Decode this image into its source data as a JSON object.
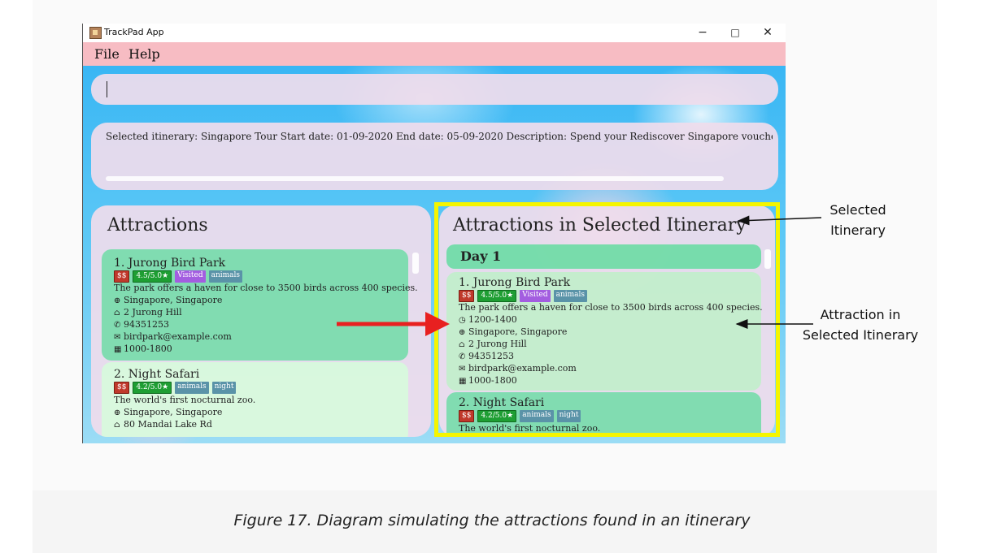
{
  "window": {
    "title": "TrackPad App",
    "controls": {
      "minimize": "−",
      "maximize": "□",
      "close": "✕"
    }
  },
  "menu": {
    "items": [
      "File",
      "Help"
    ]
  },
  "command_box": {
    "value": ""
  },
  "result_display": {
    "text": "Selected itinerary: Singapore Tour Start date: 01-09-2020 End date: 05-09-2020 Description: Spend your Rediscover Singapore vouchers here! Budg"
  },
  "attractions_panel": {
    "title": "Attractions",
    "items": [
      {
        "name": "1.  Jurong Bird Park",
        "price": "$$",
        "rating": "4.5/5.0★",
        "tags": [
          "Visited",
          "animals"
        ],
        "description": "The park offers a haven for close to 3500 birds across 400 species.",
        "location": "Singapore, Singapore",
        "address": "2 Jurong Hill",
        "phone": "94351253",
        "email": "birdpark@example.com",
        "hours": "1000-1800"
      },
      {
        "name": "2.  Night Safari",
        "price": "$$",
        "rating": "4.2/5.0★",
        "tags": [
          "animals",
          "night"
        ],
        "description": "The world's first nocturnal zoo.",
        "location": "Singapore, Singapore",
        "address": "80 Mandai Lake Rd"
      }
    ]
  },
  "itinerary_panel": {
    "title": "Attractions in Selected Itinerary",
    "day_label": "Day 1",
    "items": [
      {
        "name": "1.  Jurong Bird Park",
        "price": "$$",
        "rating": "4.5/5.0★",
        "tags": [
          "Visited",
          "animals"
        ],
        "description": "The park offers a haven for close to 3500 birds across 400 species.",
        "time": "1200-1400",
        "location": "Singapore, Singapore",
        "address": "2 Jurong Hill",
        "phone": "94351253",
        "email": "birdpark@example.com",
        "hours": "1000-1800"
      },
      {
        "name": "2.  Night Safari",
        "price": "$$",
        "rating": "4.2/5.0★",
        "tags": [
          "animals",
          "night"
        ],
        "description": "The world's first nocturnal zoo."
      }
    ]
  },
  "annotations": {
    "selected_itinerary": [
      "Selected",
      "Itinerary"
    ],
    "attraction_in_itinerary": [
      "Attraction in",
      "Selected Itinerary"
    ]
  },
  "caption": "Figure 17. Diagram simulating the attractions found in an itinerary",
  "colors": {
    "menu_bar": "#f7bcc3",
    "highlight_box": "#f5f500",
    "arrow_red": "#e82020",
    "tag_price": "#c0392b",
    "tag_rating": "#1e9e33",
    "tag_visited": "#a35de0",
    "tag_category": "#5a93a8"
  },
  "icons": {
    "location": "globe-icon",
    "address": "home-icon",
    "phone": "phone-icon",
    "email": "email-icon",
    "hours": "calendar-icon",
    "time": "clock-icon"
  }
}
